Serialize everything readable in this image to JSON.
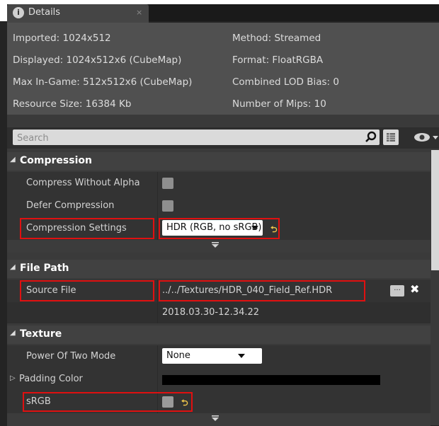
{
  "tab": {
    "title": "Details",
    "close_glyph": "×",
    "icon_glyph": "i"
  },
  "info": {
    "imported": "Imported: 1024x512",
    "displayed": "Displayed: 1024x512x6 (CubeMap)",
    "max_in_game": "Max In-Game: 512x512x6 (CubeMap)",
    "resource_size": "Resource Size: 16384 Kb",
    "method": "Method: Streamed",
    "format": "Format: FloatRGBA",
    "lod_bias": "Combined LOD Bias: 0",
    "mips": "Number of Mips: 10"
  },
  "search": {
    "placeholder": "Search"
  },
  "icons": {
    "search": "search-icon",
    "grid": "grid-view-icon",
    "eye": "eye-icon",
    "reset": "reset-arrow-icon",
    "expand": "expand-arrow-icon",
    "clear": "clear-icon",
    "browse": "browse-icon"
  },
  "compression": {
    "header": "Compression",
    "compress_without_alpha": "Compress Without Alpha",
    "defer_compression": "Defer Compression",
    "compression_settings": "Compression Settings",
    "compression_settings_value": "HDR (RGB, no sRGB)"
  },
  "file_path": {
    "header": "File Path",
    "source_file": "Source File",
    "source_file_value": "../../Textures/HDR_040_Field_Ref.HDR",
    "timestamp": "2018.03.30-12.34.22",
    "browse_label": "..."
  },
  "texture": {
    "header": "Texture",
    "power_of_two_mode": "Power Of Two Mode",
    "power_of_two_value": "None",
    "padding_color": "Padding Color",
    "padding_color_value": "#000000",
    "srgb": "sRGB"
  },
  "glyphs": {
    "collapse": "◢",
    "expand_row": "▷",
    "reset": "⮌",
    "clear": "✖"
  },
  "colors": {
    "highlight": "#e01010",
    "reset_yellow": "#f2c84b"
  }
}
